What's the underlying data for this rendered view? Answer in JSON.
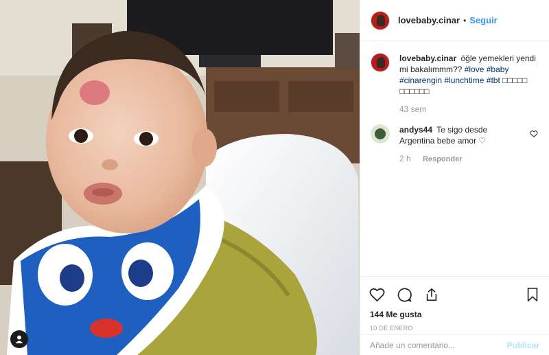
{
  "post": {
    "author": "lovebaby.cinar",
    "separator": "•",
    "follow_label": "Seguir"
  },
  "caption": {
    "username": "lovebaby.cinar",
    "text": "öğle yemekleri yendi mi bakalımmm??",
    "hashtags": [
      "#love",
      "#baby",
      "#cinarengin",
      "#lunchtime",
      "#tbt"
    ],
    "trailing": "□□□□□ □□□□□□",
    "time": "43 sem"
  },
  "comments": [
    {
      "username": "andys44",
      "text": "Te sigo desde Argentina bebe amor ♡",
      "time": "2 h",
      "reply_label": "Responder"
    }
  ],
  "stats": {
    "likes": "144 Me gusta",
    "date": "10 DE ENERO"
  },
  "comment_box": {
    "placeholder": "Añade un comentario...",
    "publish_label": "Publicar"
  },
  "icons": {
    "like": "heart-icon",
    "comment": "comment-bubble-icon",
    "share": "share-icon",
    "save": "bookmark-icon",
    "tagged_user": "user-tag-icon"
  },
  "colors": {
    "link": "#003569",
    "follow": "#3897f0",
    "publish_disabled": "#b2dffc",
    "muted": "#999999"
  }
}
